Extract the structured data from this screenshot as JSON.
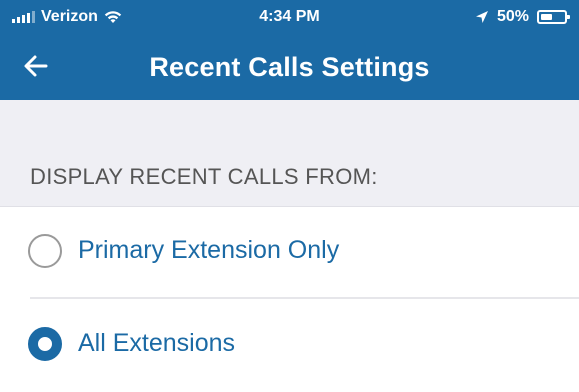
{
  "status_bar": {
    "carrier": "Verizon",
    "time": "4:34 PM",
    "battery": "50%",
    "battery_level": 0.5
  },
  "header": {
    "title": "Recent Calls Settings",
    "back_icon": "back-arrow-icon"
  },
  "section": {
    "header": "DISPLAY RECENT CALLS FROM:"
  },
  "options": [
    {
      "label": "Primary Extension Only",
      "selected": false
    },
    {
      "label": "All Extensions",
      "selected": true
    }
  ],
  "colors": {
    "brand": "#1b6aa5",
    "background_gray": "#efeff4",
    "section_text": "#555555"
  }
}
